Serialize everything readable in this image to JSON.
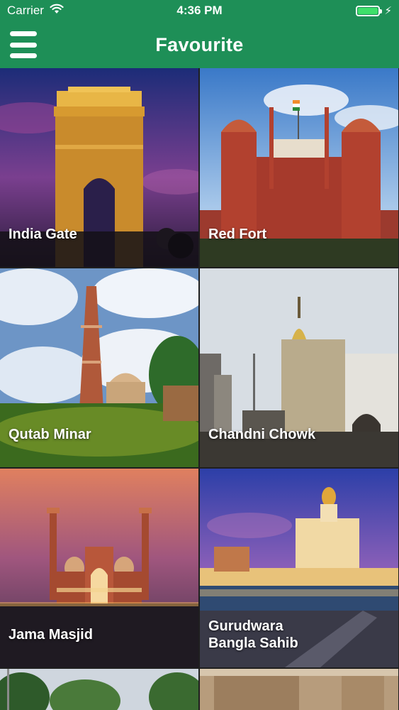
{
  "status_bar": {
    "carrier": "Carrier",
    "time": "4:36 PM",
    "battery_level": 1.0,
    "icons": [
      "wifi-icon",
      "battery-icon",
      "charging-bolt-icon"
    ]
  },
  "nav": {
    "title": "Favourite",
    "menu_icon": "hamburger-menu-icon"
  },
  "places": [
    {
      "name": "India Gate"
    },
    {
      "name": "Red Fort"
    },
    {
      "name": "Qutab Minar"
    },
    {
      "name": "Chandni Chowk"
    },
    {
      "name": "Jama Masjid"
    },
    {
      "name": "Gurudwara Bangla Sahib"
    },
    {
      "name": ""
    },
    {
      "name": ""
    }
  ],
  "colors": {
    "header": "#1e8f57",
    "battery": "#3ee06a"
  }
}
